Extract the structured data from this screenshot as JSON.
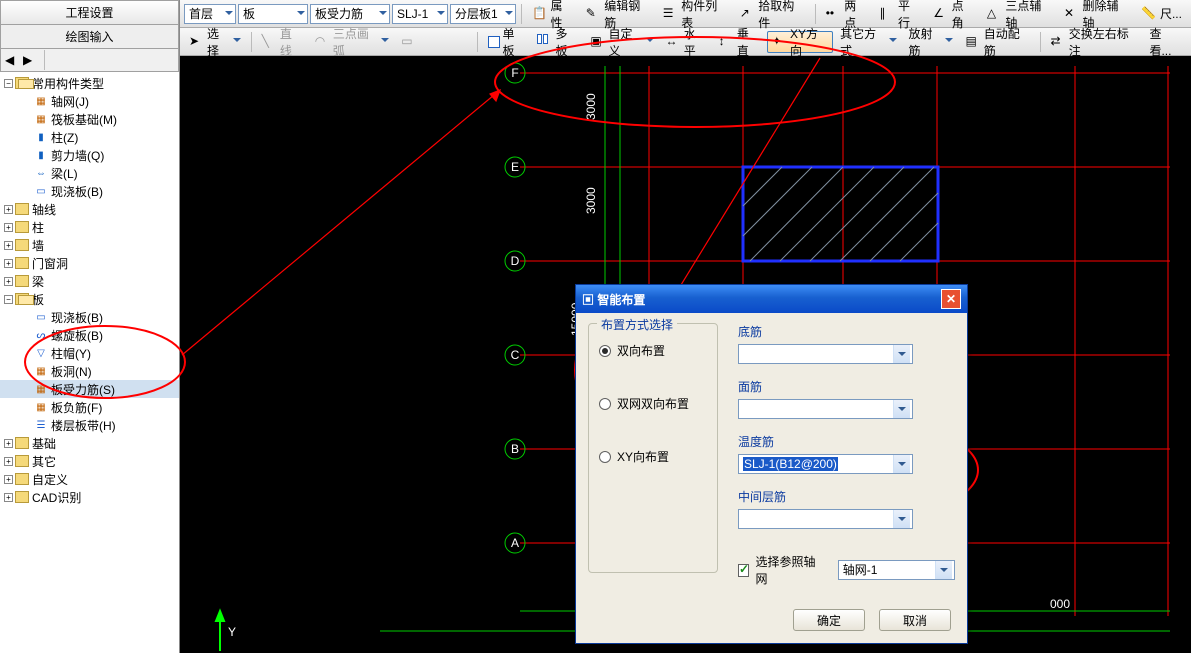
{
  "left_panel": {
    "header1": "工程设置",
    "header2": "绘图输入",
    "tree": {
      "root": "常用构件类型",
      "items": [
        {
          "label": "轴网(J)",
          "icon": "grid"
        },
        {
          "label": "筏板基础(M)",
          "icon": "grid"
        },
        {
          "label": "柱(Z)",
          "icon": "leaf"
        },
        {
          "label": "剪力墙(Q)",
          "icon": "leaf"
        },
        {
          "label": "梁(L)",
          "icon": "leaf"
        },
        {
          "label": "现浇板(B)",
          "icon": "leaf"
        }
      ],
      "folders": [
        "轴线",
        "柱",
        "墙",
        "门窗洞",
        "梁",
        "板"
      ],
      "ban_children": [
        {
          "label": "现浇板(B)"
        },
        {
          "label": "螺旋板(B)"
        },
        {
          "label": "柱帽(Y)"
        },
        {
          "label": "板洞(N)"
        },
        {
          "label": "板受力筋(S)",
          "selected": true
        },
        {
          "label": "板负筋(F)"
        },
        {
          "label": "楼层板带(H)"
        }
      ],
      "tail_folders": [
        "基础",
        "其它",
        "自定义",
        "CAD识别"
      ]
    }
  },
  "toolbar1": {
    "combo_floor": "首层",
    "combo_cat": "板",
    "combo_type": "板受力筋",
    "combo_member": "SLJ-1",
    "combo_layer": "分层板1",
    "btns": [
      "属性",
      "编辑钢筋",
      "构件列表",
      "拾取构件",
      "两点",
      "平行",
      "点角",
      "三点辅轴",
      "删除辅轴",
      "尺..."
    ]
  },
  "toolbar2": {
    "select": "选择",
    "line": "直线",
    "arc": "三点画弧",
    "single": "单板",
    "multi": "多板",
    "custom": "自定义",
    "horiz": "水平",
    "vert": "垂直",
    "xy": "XY方向",
    "other": "其它方式",
    "radiate": "放射筋",
    "auto": "自动配筋",
    "swap": "交换左右标注",
    "view": "查看..."
  },
  "dialog": {
    "title": "智能布置",
    "group_left": "布置方式选择",
    "opt1": "双向布置",
    "opt2": "双网双向布置",
    "opt3": "XY向布置",
    "lbl1": "底筋",
    "lbl2": "面筋",
    "lbl3": "温度筋",
    "lbl4": "中间层筋",
    "wendu_val": "SLJ-1(B12@200)",
    "chk_label": "选择参照轴网",
    "axis_combo": "轴网-1",
    "ok": "确定",
    "cancel": "取消"
  },
  "axes": {
    "row_labels": [
      "F",
      "E",
      "D",
      "C",
      "B",
      "A"
    ],
    "dims_v": [
      "3000",
      "3000",
      "15000"
    ],
    "dim_b": "000",
    "y_axis": "Y"
  }
}
